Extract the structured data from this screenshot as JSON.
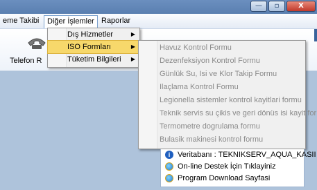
{
  "window": {
    "minimize_glyph": "—",
    "maximize_glyph": "▫",
    "close_glyph": "X"
  },
  "menubar": {
    "items": [
      {
        "label": "eme Takibi"
      },
      {
        "label": "Diğer İşlemler"
      },
      {
        "label": "Raporlar"
      }
    ]
  },
  "toolbar": {
    "button_label": "Telefon R"
  },
  "dropdown": {
    "items": [
      {
        "label": "Dış Hizmetler",
        "arrow": "▶"
      },
      {
        "label": "ISO Formları",
        "arrow": "▶"
      },
      {
        "label": "Tüketim Bilgileri",
        "arrow": "▶"
      }
    ]
  },
  "submenu": {
    "items": [
      {
        "label": "Havuz Kontrol Formu"
      },
      {
        "label": "Dezenfeksiyon Kontrol Formu"
      },
      {
        "label": "Günlük Su, Isi ve Klor Takip Formu"
      },
      {
        "label": "Ilaçlama Kontrol Formu"
      },
      {
        "label": "Legionella sistemler kontrol kayitlari formu"
      },
      {
        "label": "Teknik servis su çikis ve geri dönüs isi kayit formu"
      },
      {
        "label": "Termometre dogrulama formu"
      },
      {
        "label": "Bulasik makinesi kontrol formu"
      }
    ]
  },
  "info_panel": {
    "items": [
      {
        "label": "Veritabanı : TEKNIKSERV_AQUA_KASII",
        "icon": "info-icon"
      },
      {
        "label": "On-line Destek İçin Tıklayiniz",
        "icon": "ie-icon"
      },
      {
        "label": "Program Download Sayfasi",
        "icon": "ie-icon"
      }
    ]
  },
  "colors": {
    "highlight": "#f7d86b",
    "titlebar": "#5a7fb0",
    "close_button": "#c0392b"
  }
}
